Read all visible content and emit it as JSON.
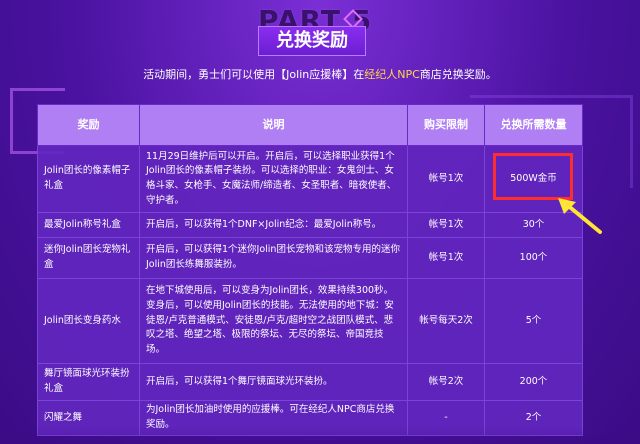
{
  "header": {
    "part_text": "PART 5",
    "title": "兑换奖励"
  },
  "intro": {
    "prefix": "活动期间，勇士们可以使用【Jolin应援棒】在",
    "highlight": "经纪人NPC",
    "suffix": "商店兑换奖励。"
  },
  "table": {
    "headers": [
      "奖励",
      "说明",
      "购买限制",
      "兑换所需数量"
    ],
    "rows": [
      {
        "reward": "Jolin团长的像素帽子礼盒",
        "description": "11月29日维护后可以开启。开启后，可以选择职业获得1个Jolin团长的像素帽子装扮。可以选择的职业：女鬼剑士、女格斗家、女枪手、女魔法师/缔造者、女圣职者、暗夜使者、守护者。",
        "limit": "帐号1次",
        "cost": "500W金币"
      },
      {
        "reward": "最爱Jolin称号礼盒",
        "description": "开启后，可以获得1个DNF×Jolin纪念：最爱Jolin称号。",
        "limit": "帐号1次",
        "cost": "30个"
      },
      {
        "reward": "迷你Jolin团长宠物礼盒",
        "description": "开启后，可以获得1个迷你Jolin团长宠物和该宠物专用的迷你Jolin团长练舞服装扮。",
        "limit": "帐号1次",
        "cost": "100个"
      },
      {
        "reward": "Jolin团长变身药水",
        "description": "在地下城使用后，可以变身为Jolin团长，效果持续300秒。变身后，可以使用Jolin团长的技能。无法使用的地下城：安徒恩/卢克普通模式、安徒恩/卢克/超时空之战团队模式、悲叹之塔、绝望之塔、极限的祭坛、无尽的祭坛、帝国竞技场。",
        "limit": "帐号每天2次",
        "cost": "5个"
      },
      {
        "reward": "舞厅镜面球光环装扮礼盒",
        "description": "开启后，可以获得1个舞厅镜面球光环装扮。",
        "limit": "帐号2次",
        "cost": "200个"
      },
      {
        "reward": "闪耀之舞",
        "description": "为Jolin团长加油时使用的应援棒。可在经纪人NPC商店兑换奖励。",
        "limit": "-",
        "cost": "2个"
      }
    ]
  },
  "colors": {
    "highlight_box": "#ff2d2d",
    "arrow": "#ffe534",
    "header_bg": "#b07ff4",
    "cell_bg": "#6226be"
  }
}
